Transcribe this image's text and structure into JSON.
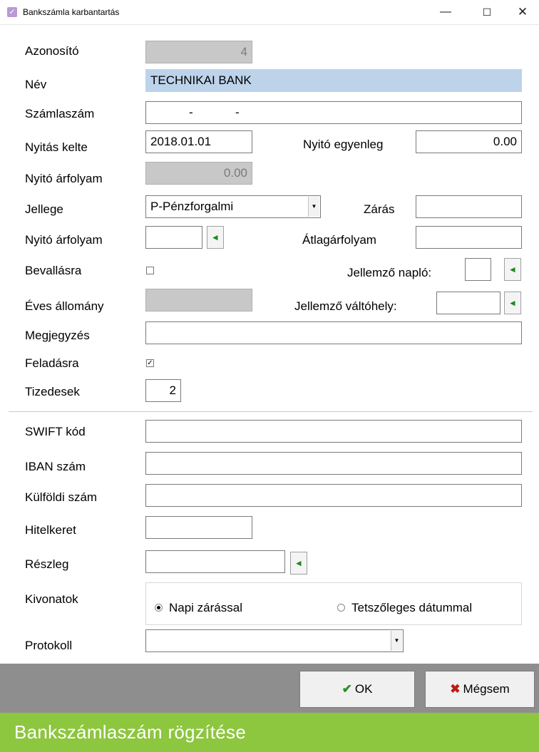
{
  "window": {
    "title": "Bankszámla karbantartás",
    "icon": "check-app-icon",
    "min": "—",
    "max": "☐",
    "close": "✕"
  },
  "form": {
    "azonosito": {
      "label": "Azonosító",
      "value": "4"
    },
    "nev": {
      "label": "Név",
      "value": "TECHNIKAI BANK"
    },
    "szamlaszam": {
      "label": "Számlaszám",
      "dash1": "-",
      "dash2": "-"
    },
    "nyitas_kelte": {
      "label": "Nyitás kelte",
      "value": "2018.01.01"
    },
    "nyito_egyenleg": {
      "label": "Nyitó egyenleg",
      "value": "0.00"
    },
    "nyito_arfolyam_ro": {
      "label": "Nyitó árfolyam",
      "value": "0.00"
    },
    "jellege": {
      "label": "Jellege",
      "value": "P-Pénzforgalmi"
    },
    "zaras": {
      "label": "Zárás",
      "value": ""
    },
    "nyito_arfolyam": {
      "label": "Nyitó árfolyam",
      "value": ""
    },
    "atlagarfolyam": {
      "label": "Átlagárfolyam",
      "value": ""
    },
    "bevallasra": {
      "label": "Bevallásra",
      "checked": false
    },
    "jellemzo_naplo": {
      "label": "Jellemző napló:",
      "value": ""
    },
    "eves_allomany": {
      "label": "Éves állomány",
      "value": ""
    },
    "jellemzo_valtohely": {
      "label": "Jellemző váltóhely:",
      "value": ""
    },
    "megjegyzes": {
      "label": "Megjegyzés",
      "value": ""
    },
    "feladasra": {
      "label": "Feladásra",
      "checked": true,
      "mark": "✓"
    },
    "tizedesek": {
      "label": "Tizedesek",
      "value": "2"
    },
    "swift": {
      "label": "SWIFT kód",
      "value": ""
    },
    "iban": {
      "label": "IBAN szám",
      "value": ""
    },
    "kulfoldi": {
      "label": "Külföldi szám",
      "value": ""
    },
    "hitelkeret": {
      "label": "Hitelkeret",
      "value": ""
    },
    "reszleg": {
      "label": "Részleg",
      "value": ""
    },
    "kivonatok": {
      "label": "Kivonatok",
      "opt1": "Napi zárással",
      "opt2": "Tetszőleges dátummal",
      "selected": "opt1"
    },
    "protokoll": {
      "label": "Protokoll",
      "value": ""
    }
  },
  "buttons": {
    "ok": "OK",
    "cancel": "Mégsem"
  },
  "caption": "Bankszámlaszám rögzítése",
  "colors": {
    "selection": "#bcd3ea",
    "readonly": "#c8c8c8",
    "bottombar": "#8e8e8e",
    "caption": "#8dc63f",
    "ok_icon": "#2a8f2a",
    "cancel_icon": "#c01818",
    "lookup_arrow": "#1a8a1a"
  }
}
